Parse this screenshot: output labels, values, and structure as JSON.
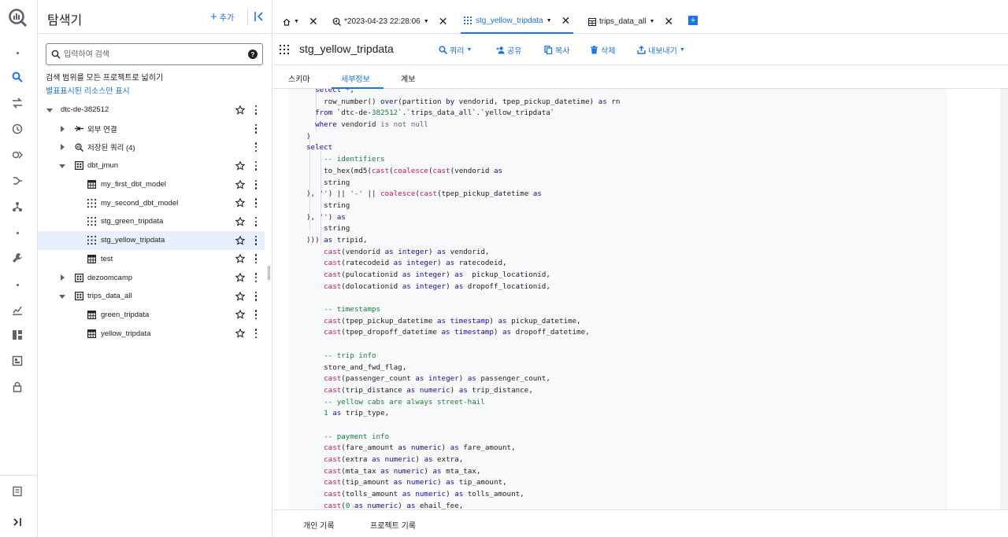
{
  "explorer": {
    "title": "탐색기",
    "add_label": "추가",
    "search_placeholder": "입력하여 검색",
    "scope_text": "검색 범위를 모든 프로젝트로 넓히기",
    "starred_link": "별표표시된 리소스만 표시",
    "tree": [
      {
        "label": "dtc-de-382512",
        "level": 0,
        "caret": "down",
        "icon": "none",
        "star": true,
        "kebab": true,
        "selected": false
      },
      {
        "label": "외부 연결",
        "level": 1,
        "caret": "right",
        "icon": "connection-icon",
        "star": false,
        "kebab": true,
        "selected": false
      },
      {
        "label": "저장된 쿼리 (4)",
        "level": 1,
        "caret": "right",
        "icon": "saved-query-icon",
        "star": false,
        "kebab": true,
        "selected": false
      },
      {
        "label": "dbt_jmun",
        "level": 1,
        "caret": "down",
        "icon": "dataset-icon",
        "star": true,
        "kebab": true,
        "selected": false
      },
      {
        "label": "my_first_dbt_model",
        "level": 2,
        "caret": "none",
        "icon": "table-icon",
        "star": true,
        "kebab": true,
        "selected": false
      },
      {
        "label": "my_second_dbt_model",
        "level": 2,
        "caret": "none",
        "icon": "view-icon",
        "star": true,
        "kebab": true,
        "selected": false
      },
      {
        "label": "stg_green_tripdata",
        "level": 2,
        "caret": "none",
        "icon": "view-icon",
        "star": true,
        "kebab": true,
        "selected": false
      },
      {
        "label": "stg_yellow_tripdata",
        "level": 2,
        "caret": "none",
        "icon": "view-icon",
        "star": true,
        "kebab": true,
        "selected": true
      },
      {
        "label": "test",
        "level": 2,
        "caret": "none",
        "icon": "table-icon",
        "star": true,
        "kebab": true,
        "selected": false
      },
      {
        "label": "dezoomcamp",
        "level": 1,
        "caret": "right",
        "icon": "dataset-icon",
        "star": true,
        "kebab": true,
        "selected": false
      },
      {
        "label": "trips_data_all",
        "level": 1,
        "caret": "down",
        "icon": "dataset-icon",
        "star": true,
        "kebab": true,
        "selected": false
      },
      {
        "label": "green_tripdata",
        "level": 2,
        "caret": "none",
        "icon": "table-icon",
        "star": true,
        "kebab": true,
        "selected": false
      },
      {
        "label": "yellow_tripdata",
        "level": 2,
        "caret": "none",
        "icon": "table-icon",
        "star": true,
        "kebab": true,
        "selected": false
      }
    ]
  },
  "tabs": [
    {
      "label": "",
      "icon": "home-icon",
      "dropdown": true,
      "active": false
    },
    {
      "label": "*2023-04-23 22:28:06",
      "icon": "query-icon",
      "dropdown": true,
      "active": false
    },
    {
      "label": "stg_yellow_tripdata",
      "icon": "view-icon",
      "dropdown": true,
      "active": true
    },
    {
      "label": "trips_data_all",
      "icon": "table-icon",
      "dropdown": true,
      "active": false
    }
  ],
  "toolbar": {
    "title": "stg_yellow_tripdata",
    "query_label": "쿼리",
    "share_label": "공유",
    "copy_label": "복사",
    "delete_label": "삭제",
    "export_label": "내보내기"
  },
  "subtabs": {
    "schema": "스키마",
    "details": "세부정보",
    "lineage": "계보"
  },
  "bottom": {
    "personal": "개인 기록",
    "project": "프로젝트 기록"
  },
  "code_lines": [
    [
      [
        0,
        "  select *,"
      ]
    ],
    [
      [
        1,
        "    row_number() "
      ],
      [
        2,
        "over"
      ],
      [
        1,
        "(partition "
      ],
      [
        2,
        "by"
      ],
      [
        1,
        " vendorid, tpep_pickup_datetime) "
      ],
      [
        2,
        "as"
      ],
      [
        1,
        " rn"
      ]
    ],
    [
      [
        2,
        "  from"
      ],
      [
        1,
        " `dtc-de-"
      ],
      [
        6,
        "382512"
      ],
      [
        1,
        "`.`trips_data_all`.`yellow_tripdata`"
      ]
    ],
    [
      [
        2,
        "  where"
      ],
      [
        1,
        " vendorid "
      ],
      [
        7,
        "is not null"
      ]
    ],
    [
      [
        1,
        ")"
      ]
    ],
    [
      [
        2,
        "select"
      ]
    ],
    [
      [
        4,
        "    -- identifiers"
      ]
    ],
    [
      [
        1,
        "    to_hex(md5("
      ],
      [
        3,
        "cast"
      ],
      [
        1,
        "("
      ],
      [
        3,
        "coalesce"
      ],
      [
        1,
        "("
      ],
      [
        3,
        "cast"
      ],
      [
        1,
        "(vendorid "
      ],
      [
        2,
        "as"
      ]
    ],
    [
      [
        1,
        "    string"
      ]
    ],
    [
      [
        1,
        "), "
      ],
      [
        5,
        "''"
      ],
      [
        1,
        ") || "
      ],
      [
        5,
        "'-'"
      ],
      [
        1,
        " || "
      ],
      [
        3,
        "coalesce"
      ],
      [
        1,
        "("
      ],
      [
        3,
        "cast"
      ],
      [
        1,
        "(tpep_pickup_datetime "
      ],
      [
        2,
        "as"
      ]
    ],
    [
      [
        1,
        "    string"
      ]
    ],
    [
      [
        1,
        "), "
      ],
      [
        5,
        "''"
      ],
      [
        1,
        ") "
      ],
      [
        2,
        "as"
      ]
    ],
    [
      [
        1,
        "    string"
      ]
    ],
    [
      [
        1,
        "))) "
      ],
      [
        2,
        "as"
      ],
      [
        1,
        " tripid,"
      ]
    ],
    [
      [
        3,
        "    cast"
      ],
      [
        1,
        "(vendorid "
      ],
      [
        2,
        "as"
      ],
      [
        1,
        " "
      ],
      [
        2,
        "integer"
      ],
      [
        1,
        ") "
      ],
      [
        2,
        "as"
      ],
      [
        1,
        " vendorid,"
      ]
    ],
    [
      [
        3,
        "    cast"
      ],
      [
        1,
        "(ratecodeid "
      ],
      [
        2,
        "as"
      ],
      [
        1,
        " "
      ],
      [
        2,
        "integer"
      ],
      [
        1,
        ") "
      ],
      [
        2,
        "as"
      ],
      [
        1,
        " ratecodeid,"
      ]
    ],
    [
      [
        3,
        "    cast"
      ],
      [
        1,
        "(pulocationid "
      ],
      [
        2,
        "as"
      ],
      [
        1,
        " "
      ],
      [
        2,
        "integer"
      ],
      [
        1,
        ") "
      ],
      [
        2,
        "as"
      ],
      [
        1,
        "  pickup_locationid,"
      ]
    ],
    [
      [
        3,
        "    cast"
      ],
      [
        1,
        "(dolocationid "
      ],
      [
        2,
        "as"
      ],
      [
        1,
        " "
      ],
      [
        2,
        "integer"
      ],
      [
        1,
        ") "
      ],
      [
        2,
        "as"
      ],
      [
        1,
        " dropoff_locationid,"
      ]
    ],
    [
      [
        1,
        ""
      ]
    ],
    [
      [
        4,
        "    -- timestamps"
      ]
    ],
    [
      [
        3,
        "    cast"
      ],
      [
        1,
        "(tpep_pickup_datetime "
      ],
      [
        2,
        "as"
      ],
      [
        1,
        " "
      ],
      [
        2,
        "timestamp"
      ],
      [
        1,
        ") "
      ],
      [
        2,
        "as"
      ],
      [
        1,
        " pickup_datetime,"
      ]
    ],
    [
      [
        3,
        "    cast"
      ],
      [
        1,
        "(tpep_dropoff_datetime "
      ],
      [
        2,
        "as"
      ],
      [
        1,
        " "
      ],
      [
        2,
        "timestamp"
      ],
      [
        1,
        ") "
      ],
      [
        2,
        "as"
      ],
      [
        1,
        " dropoff_datetime,"
      ]
    ],
    [
      [
        1,
        ""
      ]
    ],
    [
      [
        4,
        "    -- trip info"
      ]
    ],
    [
      [
        1,
        "    store_and_fwd_flag,"
      ]
    ],
    [
      [
        3,
        "    cast"
      ],
      [
        1,
        "(passenger_count "
      ],
      [
        2,
        "as"
      ],
      [
        1,
        " "
      ],
      [
        2,
        "integer"
      ],
      [
        1,
        ") "
      ],
      [
        2,
        "as"
      ],
      [
        1,
        " passenger_count,"
      ]
    ],
    [
      [
        3,
        "    cast"
      ],
      [
        1,
        "(trip_distance "
      ],
      [
        2,
        "as"
      ],
      [
        1,
        " "
      ],
      [
        2,
        "numeric"
      ],
      [
        1,
        ") "
      ],
      [
        2,
        "as"
      ],
      [
        1,
        " trip_distance,"
      ]
    ],
    [
      [
        4,
        "    -- yellow cabs are always street-hail"
      ]
    ],
    [
      [
        6,
        "    1"
      ],
      [
        1,
        " "
      ],
      [
        2,
        "as"
      ],
      [
        1,
        " trip_type,"
      ]
    ],
    [
      [
        1,
        ""
      ]
    ],
    [
      [
        4,
        "    -- payment info"
      ]
    ],
    [
      [
        3,
        "    cast"
      ],
      [
        1,
        "(fare_amount "
      ],
      [
        2,
        "as"
      ],
      [
        1,
        " "
      ],
      [
        2,
        "numeric"
      ],
      [
        1,
        ") "
      ],
      [
        2,
        "as"
      ],
      [
        1,
        " fare_amount,"
      ]
    ],
    [
      [
        3,
        "    cast"
      ],
      [
        1,
        "(extra "
      ],
      [
        2,
        "as"
      ],
      [
        1,
        " "
      ],
      [
        2,
        "numeric"
      ],
      [
        1,
        ") "
      ],
      [
        2,
        "as"
      ],
      [
        1,
        " extra,"
      ]
    ],
    [
      [
        3,
        "    cast"
      ],
      [
        1,
        "(mta_tax "
      ],
      [
        2,
        "as"
      ],
      [
        1,
        " "
      ],
      [
        2,
        "numeric"
      ],
      [
        1,
        ") "
      ],
      [
        2,
        "as"
      ],
      [
        1,
        " mta_tax,"
      ]
    ],
    [
      [
        3,
        "    cast"
      ],
      [
        1,
        "(tip_amount "
      ],
      [
        2,
        "as"
      ],
      [
        1,
        " "
      ],
      [
        2,
        "numeric"
      ],
      [
        1,
        ") "
      ],
      [
        2,
        "as"
      ],
      [
        1,
        " tip_amount,"
      ]
    ],
    [
      [
        3,
        "    cast"
      ],
      [
        1,
        "(tolls_amount "
      ],
      [
        2,
        "as"
      ],
      [
        1,
        " "
      ],
      [
        2,
        "numeric"
      ],
      [
        1,
        ") "
      ],
      [
        2,
        "as"
      ],
      [
        1,
        " tolls_amount,"
      ]
    ],
    [
      [
        3,
        "    cast"
      ],
      [
        1,
        "("
      ],
      [
        6,
        "0"
      ],
      [
        1,
        " "
      ],
      [
        2,
        "as"
      ],
      [
        1,
        " "
      ],
      [
        2,
        "numeric"
      ],
      [
        1,
        ") "
      ],
      [
        2,
        "as"
      ],
      [
        1,
        " ehail_fee,"
      ]
    ]
  ],
  "colors": {
    "accent": "#1a73e8",
    "selected_row": "#e8f0fe",
    "keyword": "#1a0dab",
    "function": "#c2185b",
    "comment": "#188038"
  }
}
